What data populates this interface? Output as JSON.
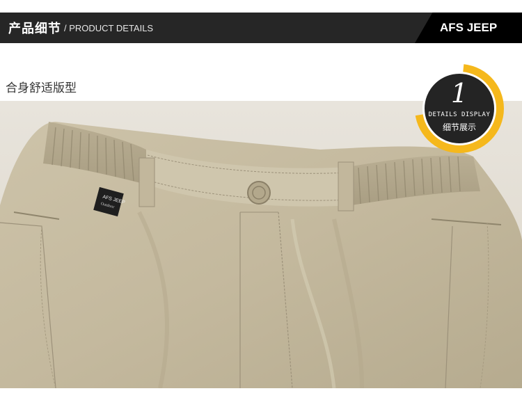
{
  "header": {
    "title_cn": "产品细节",
    "title_en": "/ PRODUCT DETAILS",
    "brand": "AFS JEEP"
  },
  "section": {
    "label": "合身舒适版型"
  },
  "badge": {
    "number": "1",
    "label_en": "DETAILS DISPLAY",
    "label_cn": "细节展示"
  },
  "photo": {
    "tag_line1": "AFS JEEP",
    "tag_line2": "Outdoor"
  },
  "colors": {
    "header_bg": "#262626",
    "badge_ring": "#f5b81c",
    "badge_fill": "#242424",
    "fabric": "#c7bca2"
  }
}
